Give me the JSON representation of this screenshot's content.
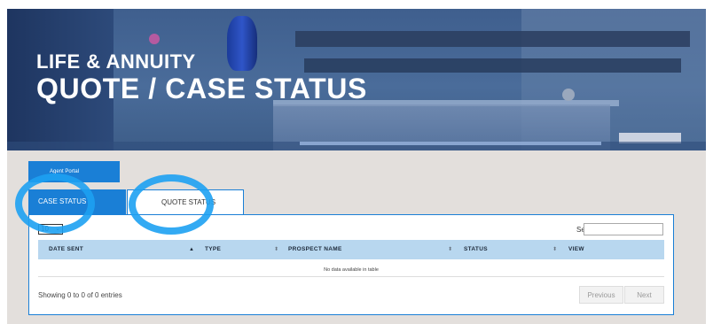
{
  "hero": {
    "line1": "LIFE & ANNUITY",
    "line2": "QUOTE / CASE STATUS"
  },
  "portal_button": "Agent Portal",
  "tabs": [
    {
      "label": "CASE STATUS",
      "active": true
    },
    {
      "label": "QUOTE STATUS",
      "active": false
    }
  ],
  "table": {
    "length_value": "10",
    "search_label": "Search:",
    "search_value": "",
    "columns": [
      "DATE SENT",
      "TYPE",
      "PROSPECT NAME",
      "STATUS",
      "VIEW"
    ],
    "sort_icons": {
      "asc": "▲",
      "both": "⬍"
    },
    "empty_message": "No data available in table",
    "info": "Showing 0 to 0 of 0 entries",
    "prev_label": "Previous",
    "next_label": "Next"
  },
  "colors": {
    "accent": "#1a7fd6",
    "header_row": "#b8d7ef",
    "annotation": "#1da1f2"
  }
}
